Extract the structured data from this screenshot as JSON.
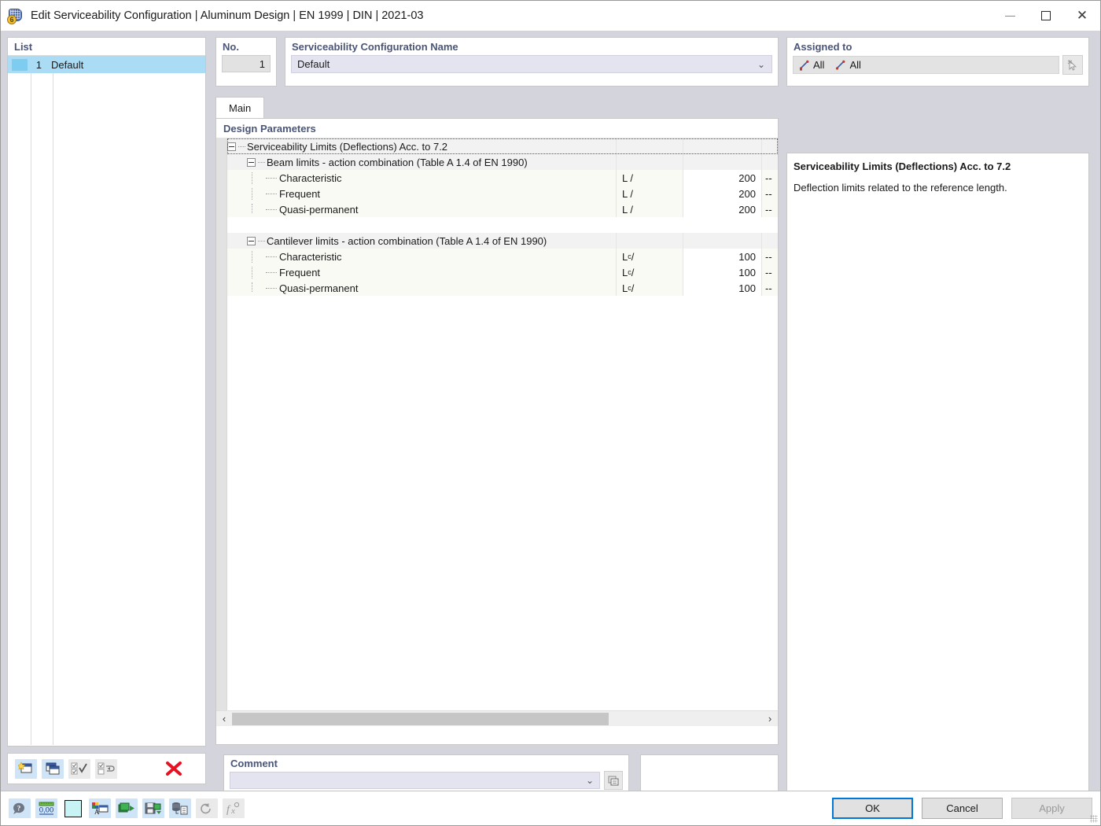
{
  "window": {
    "title": "Edit Serviceability Configuration | Aluminum Design | EN 1999 | DIN | 2021-03",
    "icon": "config-cylinder-icon",
    "minimize_label": "–",
    "maximize_label": "□",
    "close_label": "✕"
  },
  "list": {
    "label": "List",
    "rows": [
      {
        "no": "1",
        "name": "Default"
      }
    ],
    "toolbar": [
      {
        "name": "new-configuration-button",
        "tooltip": "New"
      },
      {
        "name": "copy-configuration-button",
        "tooltip": "Copy"
      },
      {
        "name": "select-all-button",
        "tooltip": "Select All"
      },
      {
        "name": "invert-selection-button",
        "tooltip": "Invert Selection"
      },
      {
        "name": "delete-configuration-button",
        "tooltip": "Delete"
      }
    ]
  },
  "no_field": {
    "label": "No.",
    "value": "1"
  },
  "name_field": {
    "label": "Serviceability Configuration Name",
    "value": "Default",
    "chevron": "⌄"
  },
  "assigned": {
    "label": "Assigned to",
    "items": [
      {
        "icon": "members-icon",
        "label": "All"
      },
      {
        "icon": "lines-icon",
        "label": "All"
      }
    ],
    "pick_button": "select-objects-button"
  },
  "tabs": [
    {
      "label": "Main",
      "active": true
    }
  ],
  "design_parameters": {
    "label": "Design Parameters",
    "tree": [
      {
        "level": 0,
        "kind": "group",
        "expanded": true,
        "selected": true,
        "label": "Serviceability Limits (Deflections) Acc. to 7.2",
        "symbol": "",
        "value": "",
        "unit": ""
      },
      {
        "level": 1,
        "kind": "group",
        "expanded": true,
        "selected": false,
        "label": "Beam limits - action combination (Table A 1.4 of EN 1990)",
        "symbol": "",
        "value": "",
        "unit": ""
      },
      {
        "level": 2,
        "kind": "leaf",
        "label": "Characteristic",
        "symbol": "L /",
        "symbol_sub": "",
        "value": "200",
        "unit": "--"
      },
      {
        "level": 2,
        "kind": "leaf",
        "label": "Frequent",
        "symbol": "L /",
        "symbol_sub": "",
        "value": "200",
        "unit": "--"
      },
      {
        "level": 2,
        "kind": "leaf",
        "label": "Quasi-permanent",
        "symbol": "L /",
        "symbol_sub": "",
        "value": "200",
        "unit": "--"
      },
      {
        "level": 2,
        "kind": "spacer",
        "label": "",
        "symbol": "",
        "value": "",
        "unit": ""
      },
      {
        "level": 1,
        "kind": "group",
        "expanded": true,
        "selected": false,
        "label": "Cantilever limits - action combination (Table A 1.4 of EN 1990)",
        "symbol": "",
        "value": "",
        "unit": ""
      },
      {
        "level": 2,
        "kind": "leaf",
        "label": "Characteristic",
        "symbol": "L",
        "symbol_sub": "c",
        "symbol_tail": " /",
        "value": "100",
        "unit": "--"
      },
      {
        "level": 2,
        "kind": "leaf",
        "label": "Frequent",
        "symbol": "L",
        "symbol_sub": "c",
        "symbol_tail": " /",
        "value": "100",
        "unit": "--"
      },
      {
        "level": 2,
        "kind": "leaf",
        "label": "Quasi-permanent",
        "symbol": "L",
        "symbol_sub": "c",
        "symbol_tail": " /",
        "value": "100",
        "unit": "--"
      }
    ],
    "hscroll": {
      "left_arrow": "‹",
      "right_arrow": "›",
      "thumb_percent": 71
    }
  },
  "comment": {
    "label": "Comment",
    "value": "",
    "placeholder": "",
    "chevron": "⌄",
    "button": "comment-library-button"
  },
  "info": {
    "title": "Serviceability Limits (Deflections) Acc. to 7.2",
    "text": "Deflection limits related to the reference length."
  },
  "footer": {
    "tools": [
      {
        "name": "help-button",
        "tooltip": "Help"
      },
      {
        "name": "units-decimals-button",
        "tooltip": "Units and Decimal Places"
      },
      {
        "name": "color-swatch-button",
        "tooltip": "Color"
      },
      {
        "name": "display-properties-button",
        "tooltip": "Display Properties"
      },
      {
        "name": "import-button",
        "tooltip": "Import"
      },
      {
        "name": "export-button",
        "tooltip": "Export"
      },
      {
        "name": "database-button",
        "tooltip": "Database"
      },
      {
        "name": "reset-button",
        "tooltip": "Reset",
        "disabled": true
      },
      {
        "name": "formula-button",
        "tooltip": "Formula",
        "disabled": true
      }
    ],
    "ok_label": "OK",
    "cancel_label": "Cancel",
    "apply_label": "Apply",
    "apply_disabled": true
  },
  "colors": {
    "window_chrome": "#d4d4dc",
    "accent_heading": "#4a5578",
    "selection": "#aadcf5",
    "field_lavender": "#e4e4f0",
    "leaf_row": "#fafaf5",
    "group_row": "#f2f2f2",
    "focus_blue": "#0078d7",
    "delete_red": "#e81123"
  }
}
